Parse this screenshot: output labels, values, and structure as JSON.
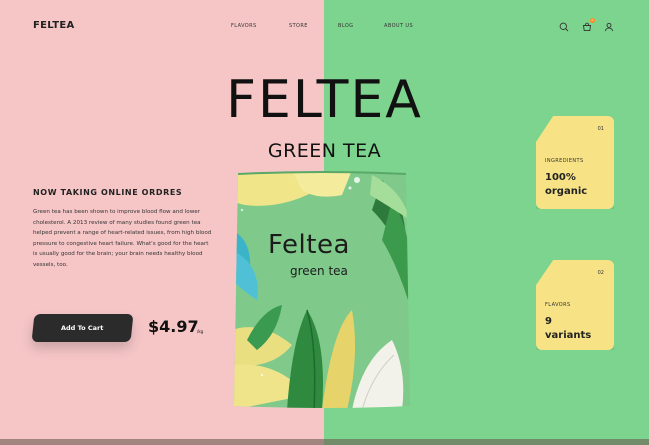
{
  "brand": "FELTEA",
  "nav": {
    "items": [
      {
        "label": "FLAVORS"
      },
      {
        "label": "STORE"
      },
      {
        "label": "BLOG"
      },
      {
        "label": "ABOUT US"
      }
    ]
  },
  "header_icons": {
    "search": "search-icon",
    "cart": "cart-icon",
    "cart_badge": "0",
    "user": "user-icon"
  },
  "hero": {
    "title": "FELTEA",
    "subtitle": "GREEN TEA"
  },
  "intro": {
    "heading": "NOW TAKING ONLINE ORDRES",
    "body": "Green tea has been shown to improve blood flow and lower cholesterol. A 2013 review of many studies found green tea helped prevent a range of heart-related issues, from high blood pressure to congestive heart failure. What's good for the heart is usually good for the brain; your brain needs healthy blood vessels, too."
  },
  "purchase": {
    "button_label": "Add To Cart",
    "price": "$4.97",
    "unit": "/kg"
  },
  "product": {
    "brand": "Feltea",
    "name": "green tea"
  },
  "cards": [
    {
      "number": "01",
      "label": "INGREDIENTS",
      "value": "100%\norganic"
    },
    {
      "number": "02",
      "label": "FLAVORS",
      "value": "9\nvariants"
    }
  ],
  "colors": {
    "left_bg": "#f6c6c7",
    "right_bg": "#7dd48e",
    "card_bg": "#f7e386",
    "button_bg": "#2b2b2b",
    "badge": "#ff8a1e"
  }
}
